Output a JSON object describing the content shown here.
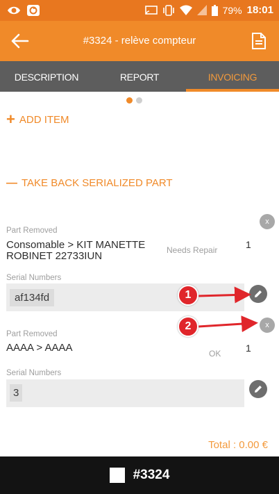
{
  "status_bar": {
    "battery": "79%",
    "time": "18:01",
    "icons": [
      "eye-icon",
      "cast-icon",
      "vibrate-icon",
      "wifi-icon",
      "signal-icon",
      "battery-icon"
    ]
  },
  "app_bar": {
    "title": "#3324 - relève compteur",
    "back_icon": "arrow-left-icon",
    "document_icon": "document-icon"
  },
  "tabs": [
    {
      "label": "DESCRIPTION",
      "active": false
    },
    {
      "label": "REPORT",
      "active": false
    },
    {
      "label": "INVOICING",
      "active": true
    }
  ],
  "pager": {
    "count": 2,
    "active_index": 0
  },
  "add_item": {
    "symbol": "+",
    "label": "ADD ITEM"
  },
  "take_back": {
    "symbol": "—",
    "label": "TAKE BACK SERIALIZED PART"
  },
  "parts": [
    {
      "removed_label": "Part Removed",
      "name_line1": "Consomable > KIT MANETTE",
      "name_line2": "ROBINET 22733IUN",
      "status": "Needs Repair",
      "quantity": "1",
      "serial_label": "Serial Numbers",
      "serial": "af134fd",
      "remove_label": "x"
    },
    {
      "removed_label": "Part Removed",
      "name_line1": "AAAA > AAAA",
      "name_line2": "",
      "status": "OK",
      "quantity": "1",
      "serial_label": "Serial Numbers",
      "serial": "3",
      "remove_label": "x"
    }
  ],
  "annotations": [
    "1",
    "2"
  ],
  "total": "Total : 0.00 €",
  "footer": {
    "label": "#3324"
  },
  "colors": {
    "accent": "#f08a29",
    "tabs_bg": "#5d5d5d",
    "annotation": "#e0262b"
  }
}
